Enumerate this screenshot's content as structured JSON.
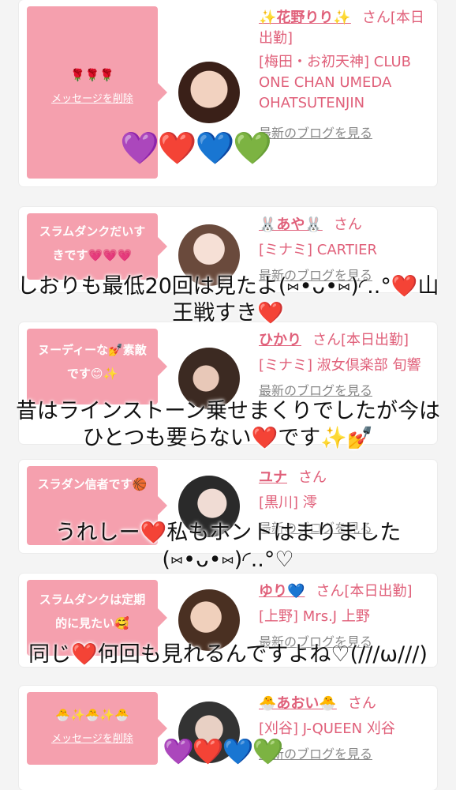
{
  "colors": {
    "accent": "#e0607a",
    "bubble": "#f5a0ae"
  },
  "cards": [
    {
      "bubble_text": "🌹🌹🌹",
      "bubble_link": "メッセージを削除",
      "name": "✨花野りり✨",
      "suffix": "さん[本日出勤]",
      "shop": "[梅田・お初天神] CLUB ONE CHAN UMEDA OHATSUTENJIN",
      "blog": "最新のブログを見る"
    },
    {
      "bubble_text": "スラムダンクだいすきです💗💗💗",
      "name": "🐰あや🐰",
      "suffix": "さん",
      "shop": "[ミナミ] CARTIER",
      "blog": "最新のブログを見る"
    },
    {
      "bubble_text": "ヌーディーな💅素敵です😊✨",
      "name": "ひかり",
      "suffix": "さん[本日出勤]",
      "shop": "[ミナミ] 淑女倶楽部 旬響",
      "blog": "最新のブログを見る"
    },
    {
      "bubble_text": "スラダン信者です🏀",
      "name": "ユナ",
      "suffix": "さん",
      "shop": "[黒川] 澪",
      "blog": "最新のブログを見る"
    },
    {
      "bubble_text": "スラムダンクは定期的に見たい🥰",
      "name": "ゆり💙",
      "suffix": "さん[本日出勤]",
      "shop": "[上野] Mrs.J 上野",
      "blog": "最新のブログを見る"
    },
    {
      "bubble_text": "🐣✨🐣✨🐣",
      "bubble_link": "メッセージを削除",
      "name": "🐣あおい🐣",
      "suffix": "さん",
      "shop": "[刈谷] J-QUEEN 刈谷",
      "blog": "最新のブログを見る"
    }
  ],
  "hearts_top": "💜❤️💙💚",
  "hearts_bottom": "💜❤️💙💚",
  "overlays": [
    "しおりも最低20回は見たよ(⑅•ᴗ•⑅)◜..°❤️山王戦すき❤️",
    "昔はラインストーン乗せまくりでしたが今はひとつも要らない❤️です✨💅",
    "うれしー❤️私もホントはまりました(⑅•ᴗ•⑅)◜..°♡",
    "同じ❤️何回も見れるんですよね♡(///ω///)"
  ]
}
